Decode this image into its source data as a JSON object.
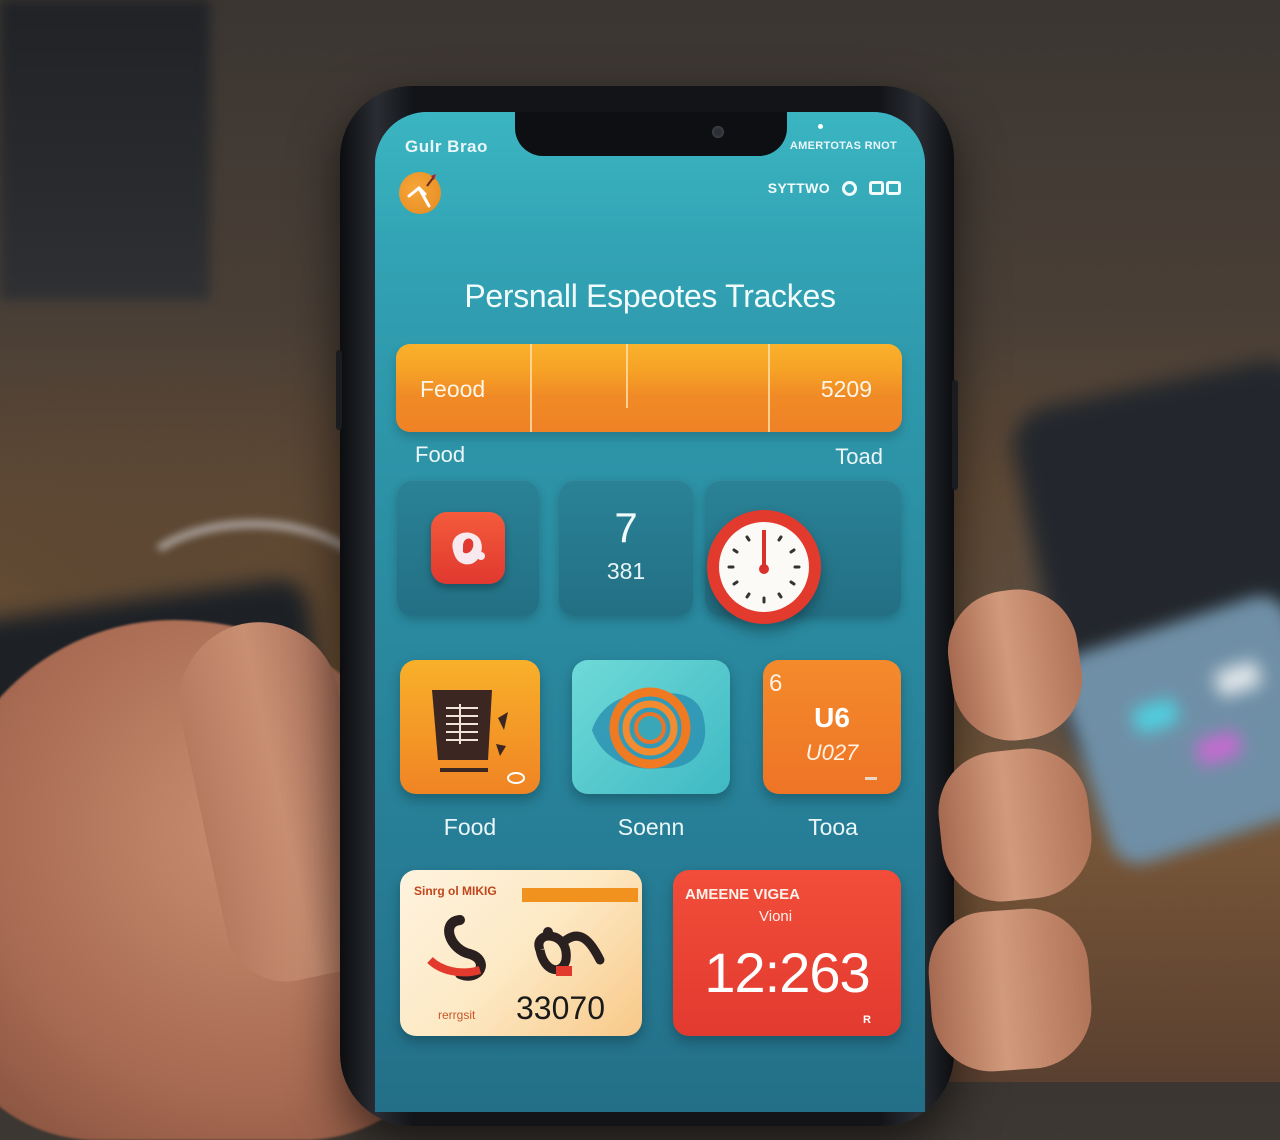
{
  "status_bar": {
    "left_text": "Gulr Brao",
    "right_text": "AMERTOTAS RNOT"
  },
  "header": {
    "menu_label": "SYTTWO",
    "icons": [
      "logo-badge-icon",
      "circle-toggle-icon",
      "cards-icon"
    ]
  },
  "page": {
    "title": "Persnall Espeotes Trackes"
  },
  "summary": {
    "label": "Feood",
    "value": "5209",
    "below_left": "Food",
    "below_right": "Toad"
  },
  "widgets": {
    "counter_top": "7",
    "counter_bottom": "381",
    "icons": [
      "red-app-icon",
      "clock-icon"
    ]
  },
  "apps": [
    {
      "label": "Food",
      "icon": "receipt-basket-icon",
      "color": "#f59a22"
    },
    {
      "label": "Soenn",
      "icon": "spiral-icon",
      "color": "#4fc7cc"
    },
    {
      "label": "Tooa",
      "icon": "calendar-stat-icon",
      "color": "#f2812b",
      "corner_text": "6",
      "line1": "U6",
      "line2": "U027"
    }
  ],
  "cards": {
    "left": {
      "header": "Sinrg ol MIKIG",
      "footer_label": "rerrgsit",
      "value": "33070"
    },
    "right": {
      "header": "AMEENE VIGEA",
      "header2": "Vioni",
      "value": "12:263",
      "mini": "R"
    }
  },
  "colors": {
    "screen_teal": "#2f9aad",
    "accent_orange": "#f39a24",
    "accent_red": "#e53c30"
  }
}
